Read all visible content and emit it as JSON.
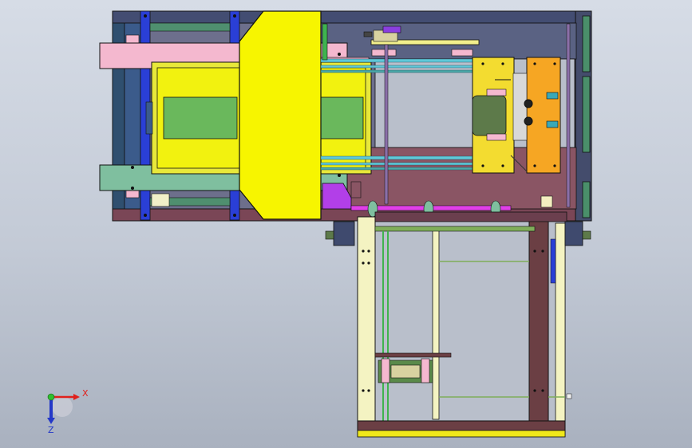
{
  "viewport": {
    "background_top": "#d6dce6",
    "background_bottom": "#a9b1bf"
  },
  "palette": {
    "frame_navy": "#3f4a6e",
    "frame_maroon": "#6b3f4e",
    "yellow": "#f2f20f",
    "pale_yellow": "#f4f3c2",
    "pink": "#f4b8cf",
    "magenta": "#e13fe8",
    "green": "#5cb85c",
    "teal": "#4aa8a8",
    "cyan": "#5fc8d8",
    "orange": "#f6a623",
    "violet": "#8a3fe0",
    "sage": "#7fbf9f",
    "blue": "#2a3fd6"
  },
  "triad": {
    "x_label": "X",
    "z_label": "Z",
    "x_color": "#e0201c",
    "y_color": "#2fbf2f",
    "z_color": "#2438c8"
  }
}
